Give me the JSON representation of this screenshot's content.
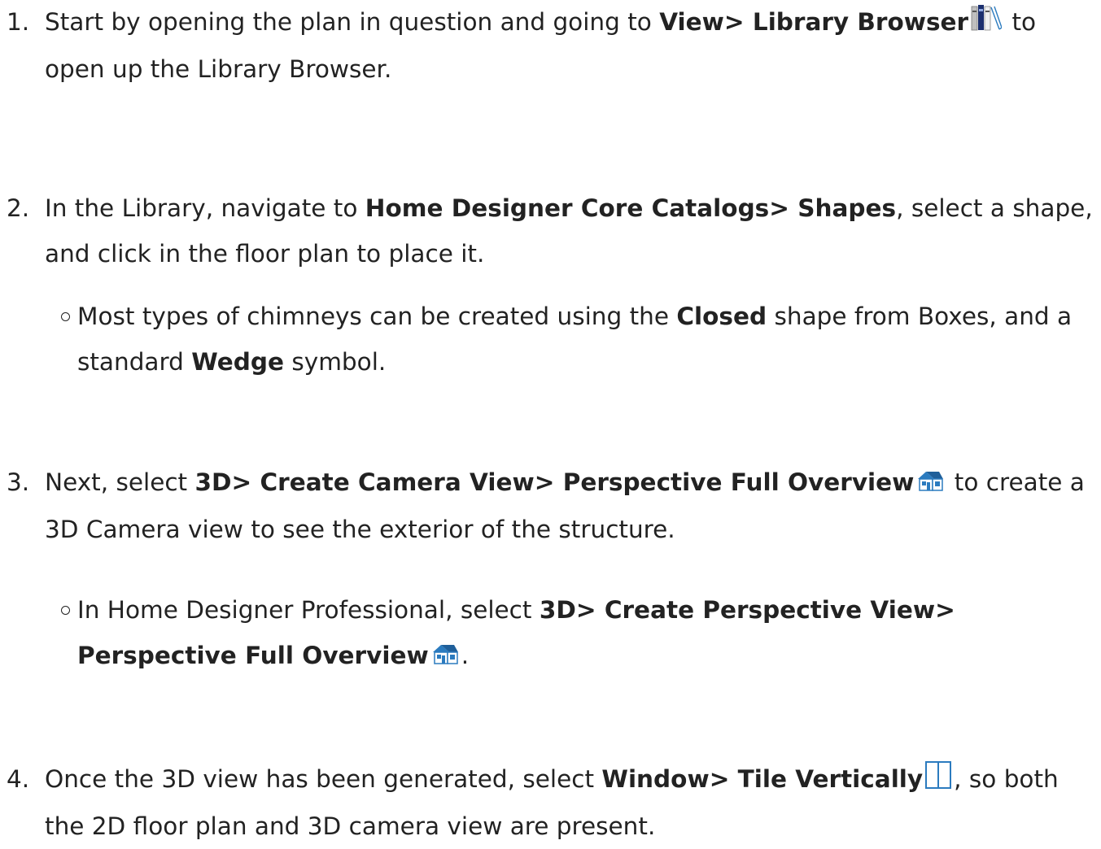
{
  "steps": [
    {
      "number": "1.",
      "before": "Start by opening the plan in question and going to ",
      "bold": "View> Library Browser",
      "icon": "library-browser-icon",
      "after": " to open up the Library Browser."
    },
    {
      "number": "2.",
      "before": "In the Library, navigate to ",
      "bold": "Home Designer Core Catalogs> Shapes",
      "after": ", select a shape, and click in the floor plan to place it.",
      "sub": {
        "before": "Most types of chimneys can be created using the ",
        "bold1": "Closed",
        "middle": " shape from Boxes, and a standard ",
        "bold2": "Wedge",
        "after": " symbol."
      }
    },
    {
      "number": "3.",
      "before": "Next, select ",
      "bold": "3D> Create Camera View> Perspective Full Overview",
      "icon": "perspective-overview-icon",
      "after": " to create a 3D Camera view to see the exterior of the structure.",
      "sub": {
        "before": "In Home Designer Professional, select ",
        "bold": "3D> Create Perspective View> Perspective Full Overview",
        "icon": "perspective-overview-icon",
        "after": "."
      }
    },
    {
      "number": "4.",
      "before": "Once the 3D view has been generated, select ",
      "bold": "Window> Tile Vertically",
      "icon": "tile-vertically-icon",
      "after": ", so both the 2D floor plan and 3D camera view are present."
    }
  ],
  "colors": {
    "text": "#222222",
    "icon_blue": "#2b7bbf",
    "icon_navy": "#1c2f6e"
  }
}
